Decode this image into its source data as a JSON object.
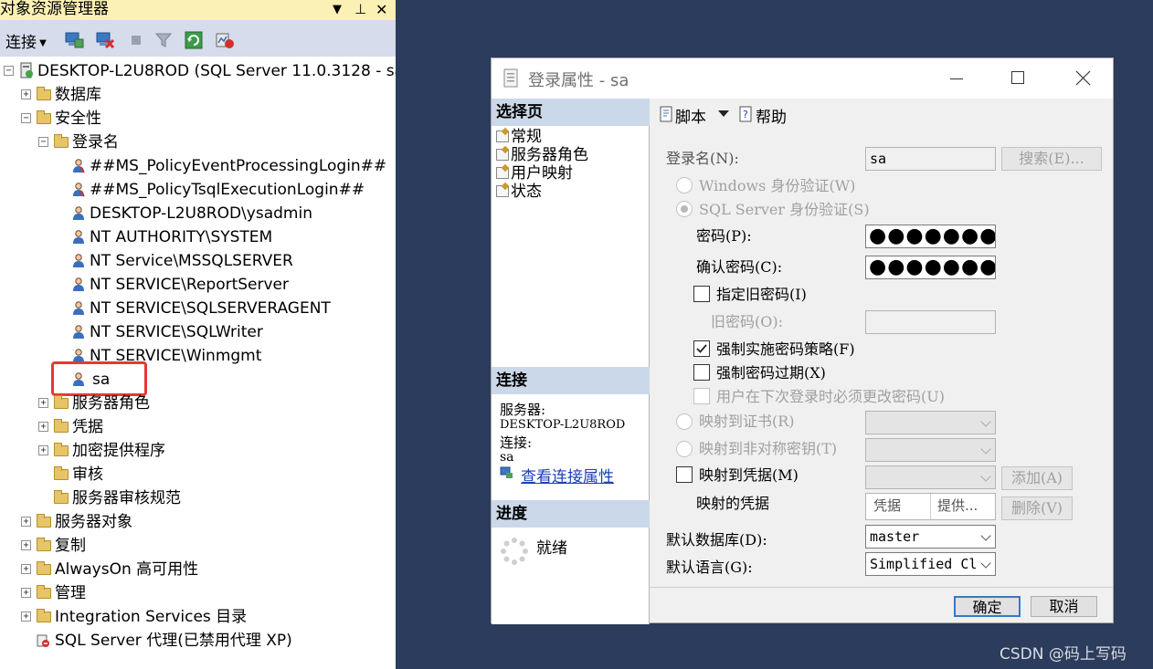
{
  "explorer": {
    "title": "对象资源管理器",
    "title_controls": [
      "▼",
      "⊥",
      "✕"
    ],
    "connect_label": "连接",
    "tree": {
      "server": "DESKTOP-L2U8ROD (SQL Server 11.0.3128 - sa)",
      "databases": "数据库",
      "security": "安全性",
      "logins": "登录名",
      "login_items": [
        "##MS_PolicyEventProcessingLogin##",
        "##MS_PolicyTsqlExecutionLogin##",
        "DESKTOP-L2U8ROD\\ysadmin",
        "NT AUTHORITY\\SYSTEM",
        "NT Service\\MSSQLSERVER",
        "NT SERVICE\\ReportServer",
        "NT SERVICE\\SQLSERVERAGENT",
        "NT SERVICE\\SQLWriter",
        "NT SERVICE\\Winmgmt",
        "sa"
      ],
      "server_roles": "服务器角色",
      "credentials": "凭据",
      "crypto_providers": "加密提供程序",
      "audits": "审核",
      "audit_specs": "服务器审核规范",
      "server_objects": "服务器对象",
      "replication": "复制",
      "alwayson": "AlwaysOn 高可用性",
      "management": "管理",
      "integration": "Integration Services 目录",
      "agent": "SQL Server 代理(已禁用代理 XP)"
    },
    "highlight_color": "#e53935"
  },
  "dialog": {
    "title": "登录属性 - sa",
    "select_page_header": "选择页",
    "pages": [
      "常规",
      "服务器角色",
      "用户映射",
      "状态"
    ],
    "connection_header": "连接",
    "server_label": "服务器:",
    "server_value": "DESKTOP-L2U8ROD",
    "connection_label": "连接:",
    "connection_value": "sa",
    "view_conn_props": "查看连接属性",
    "progress_header": "进度",
    "progress_status": "就绪",
    "toolbar": {
      "script": "脚本",
      "help": "帮助"
    },
    "form": {
      "login_name_label": "登录名(N):",
      "login_name_value": "sa",
      "search_button": "搜索(E)...",
      "windows_auth": "Windows 身份验证(W)",
      "sql_auth": "SQL Server 身份验证(S)",
      "password_label": "密码(P):",
      "password_value": "●●●●●●●●",
      "confirm_label": "确认密码(C):",
      "confirm_value": "●●●●●●●●",
      "specify_old": "指定旧密码(I)",
      "old_password_label": "旧密码(O):",
      "enforce_policy": "强制实施密码策略(F)",
      "enforce_expiration": "强制密码过期(X)",
      "must_change": "用户在下次登录时必须更改密码(U)",
      "map_cert": "映射到证书(R)",
      "map_asym": "映射到非对称密钥(T)",
      "map_cred": "映射到凭据(M)",
      "add_button": "添加(A)",
      "mapped_creds_label": "映射的凭据",
      "cred_col1": "凭据",
      "cred_col2": "提供...",
      "remove_button": "删除(V)",
      "default_db_label": "默认数据库(D):",
      "default_db_value": "master",
      "default_lang_label": "默认语言(G):",
      "default_lang_value": "Simplified Cl"
    },
    "ok_button": "确定",
    "cancel_button": "取消"
  },
  "watermark": "CSDN @码上写码"
}
